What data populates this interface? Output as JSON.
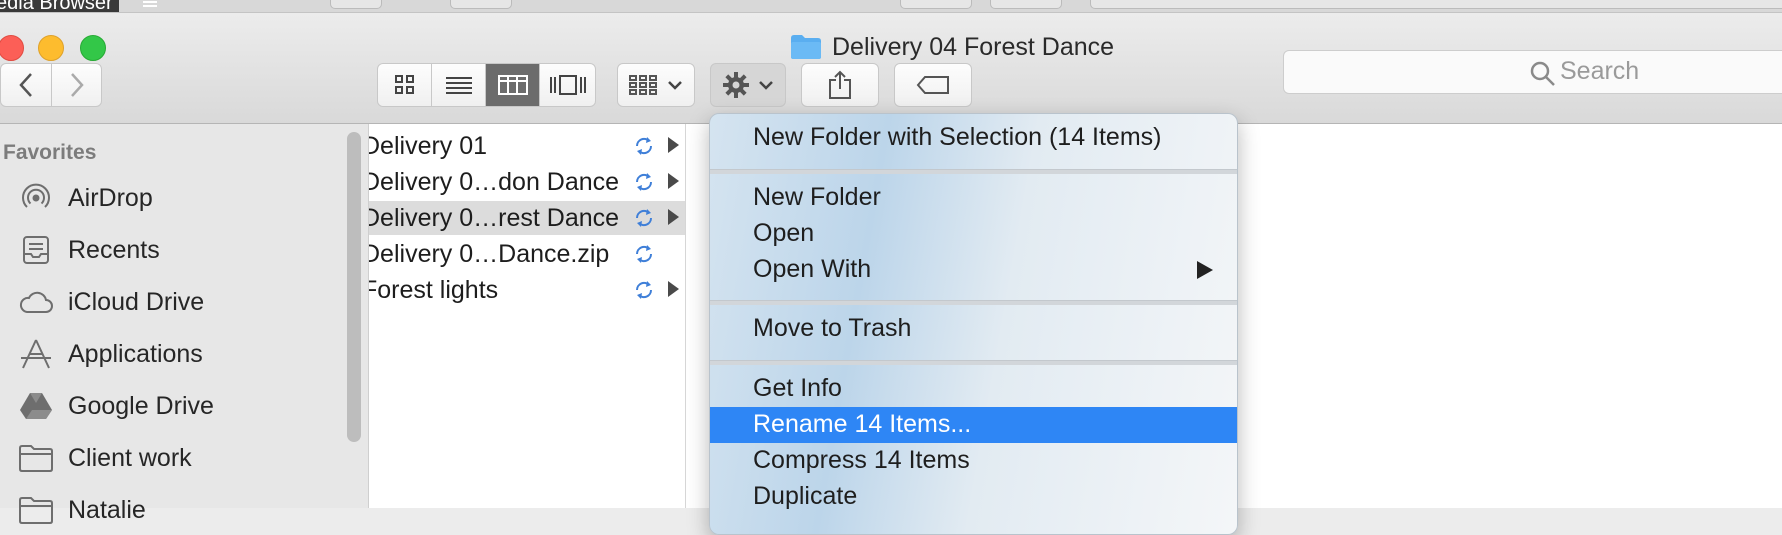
{
  "background_app": {
    "title": "edia Browser"
  },
  "window": {
    "title": "Delivery 04 Forest Dance"
  },
  "toolbar": {
    "view_modes": [
      "icon-view",
      "list-view",
      "column-view",
      "cover-flow-view"
    ],
    "active_view": "column-view"
  },
  "search": {
    "placeholder": "Search"
  },
  "sidebar": {
    "section": "Favorites",
    "items": [
      {
        "label": "AirDrop",
        "icon": "airdrop-icon"
      },
      {
        "label": "Recents",
        "icon": "recents-icon"
      },
      {
        "label": "iCloud Drive",
        "icon": "cloud-icon"
      },
      {
        "label": "Applications",
        "icon": "applications-icon"
      },
      {
        "label": "Google Drive",
        "icon": "google-drive-icon"
      },
      {
        "label": "Client work",
        "icon": "folder-icon"
      },
      {
        "label": "Natalie",
        "icon": "folder-icon"
      }
    ]
  },
  "files": [
    {
      "name": "Delivery 01",
      "has_children": true,
      "selected": false
    },
    {
      "name": "Delivery 0…don Dance",
      "has_children": true,
      "selected": false
    },
    {
      "name": "Delivery 0…rest Dance",
      "has_children": true,
      "selected": true
    },
    {
      "name": "Delivery 0…Dance.zip",
      "has_children": false,
      "selected": false
    },
    {
      "name": "Forest lights",
      "has_children": true,
      "selected": false
    }
  ],
  "context_menu": {
    "items": [
      "New Folder with Selection (14 Items)",
      "New Folder",
      "Open",
      "Open With",
      "Move to Trash",
      "Get Info",
      "Rename 14 Items...",
      "Compress 14 Items",
      "Duplicate"
    ],
    "highlighted": "Rename 14 Items..."
  },
  "colors": {
    "accent": "#2e86f5",
    "sync": "#3f7fd8",
    "folder": "#5aaef0"
  }
}
